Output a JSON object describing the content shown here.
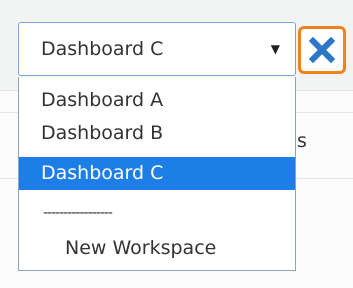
{
  "colors": {
    "selected_bg": "#1e7ee8",
    "close_border": "#f0821e",
    "close_icon": "#2a78c7"
  },
  "background": {
    "partial_text": "s"
  },
  "select": {
    "value": "Dashboard C"
  },
  "icons": {
    "arrow": "dropdown-arrow-icon",
    "close": "close-x-icon"
  },
  "dropdown": {
    "options": [
      {
        "label": "Dashboard A"
      },
      {
        "label": "Dashboard B"
      },
      {
        "label": "Dashboard C",
        "selected": true
      },
      {
        "label": "-----------------"
      },
      {
        "label": "New Workspace"
      }
    ]
  }
}
